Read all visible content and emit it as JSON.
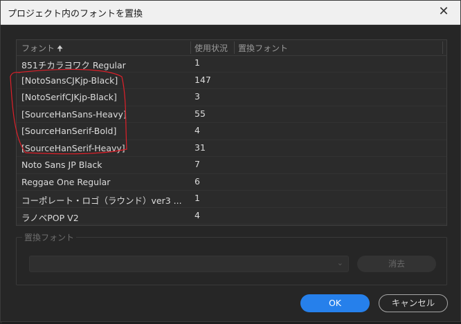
{
  "dialog": {
    "title": "プロジェクト内のフォントを置換",
    "close_glyph": "✕"
  },
  "table": {
    "headers": {
      "font": "フォント",
      "sort_glyph": "🠉",
      "usage": "使用状況",
      "replace": "置換フォント"
    },
    "rows": [
      {
        "font": "851チカラヨワク Regular",
        "usage": "1"
      },
      {
        "font": "[NotoSansCJKjp-Black]",
        "usage": "147"
      },
      {
        "font": "[NotoSerifCJKjp-Black]",
        "usage": "3"
      },
      {
        "font": "[SourceHanSans-Heavy]",
        "usage": "55"
      },
      {
        "font": "[SourceHanSerif-Bold]",
        "usage": "4"
      },
      {
        "font": "[SourceHanSerif-Heavy]",
        "usage": "31"
      },
      {
        "font": "Noto Sans JP Black",
        "usage": "7"
      },
      {
        "font": "Reggae One Regular",
        "usage": "6"
      },
      {
        "font": "コーポレート・ロゴ（ラウンド）ver3 ...",
        "usage": "1"
      },
      {
        "font": "ラノベPOP V2",
        "usage": "4"
      }
    ]
  },
  "replace_group": {
    "legend": "置換フォント",
    "select_value": "",
    "chevron_glyph": "⌄",
    "delete_label": "消去"
  },
  "buttons": {
    "ok": "OK",
    "cancel": "キャンセル"
  },
  "colors": {
    "accent": "#2680eb",
    "annotation": "#e0202a"
  }
}
